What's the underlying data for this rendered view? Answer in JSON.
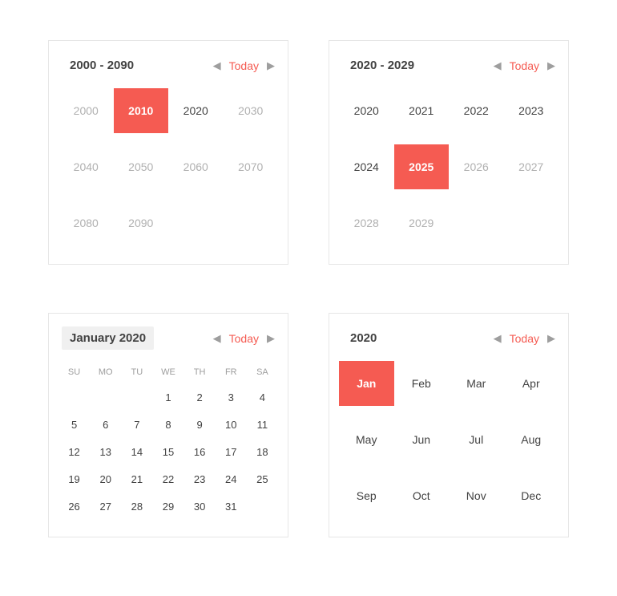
{
  "accent": "#F55B52",
  "today_label": "Today",
  "panels": {
    "century": {
      "title": "2000 - 2090",
      "cells": [
        {
          "label": "2000",
          "muted": true
        },
        {
          "label": "2010",
          "selected": true
        },
        {
          "label": "2020"
        },
        {
          "label": "2030",
          "muted": true
        },
        {
          "label": "2040",
          "muted": true
        },
        {
          "label": "2050",
          "muted": true
        },
        {
          "label": "2060",
          "muted": true
        },
        {
          "label": "2070",
          "muted": true
        },
        {
          "label": "2080",
          "muted": true
        },
        {
          "label": "2090",
          "muted": true
        }
      ]
    },
    "decade": {
      "title": "2020 - 2029",
      "cells": [
        {
          "label": "2020"
        },
        {
          "label": "2021"
        },
        {
          "label": "2022"
        },
        {
          "label": "2023"
        },
        {
          "label": "2024"
        },
        {
          "label": "2025",
          "selected": true
        },
        {
          "label": "2026",
          "muted": true
        },
        {
          "label": "2027",
          "muted": true
        },
        {
          "label": "2028",
          "muted": true
        },
        {
          "label": "2029",
          "muted": true
        }
      ]
    },
    "month": {
      "title": "January 2020",
      "weekdays": [
        "SU",
        "MO",
        "TU",
        "WE",
        "TH",
        "FR",
        "SA"
      ],
      "leading_blanks": 3,
      "days": [
        1,
        2,
        3,
        4,
        5,
        6,
        7,
        8,
        9,
        10,
        11,
        12,
        13,
        14,
        15,
        16,
        17,
        18,
        19,
        20,
        21,
        22,
        23,
        24,
        25,
        26,
        27,
        28,
        29,
        30,
        31
      ]
    },
    "year": {
      "title": "2020",
      "cells": [
        {
          "label": "Jan",
          "selected": true
        },
        {
          "label": "Feb"
        },
        {
          "label": "Mar"
        },
        {
          "label": "Apr"
        },
        {
          "label": "May"
        },
        {
          "label": "Jun"
        },
        {
          "label": "Jul"
        },
        {
          "label": "Aug"
        },
        {
          "label": "Sep"
        },
        {
          "label": "Oct"
        },
        {
          "label": "Nov"
        },
        {
          "label": "Dec"
        }
      ]
    }
  }
}
